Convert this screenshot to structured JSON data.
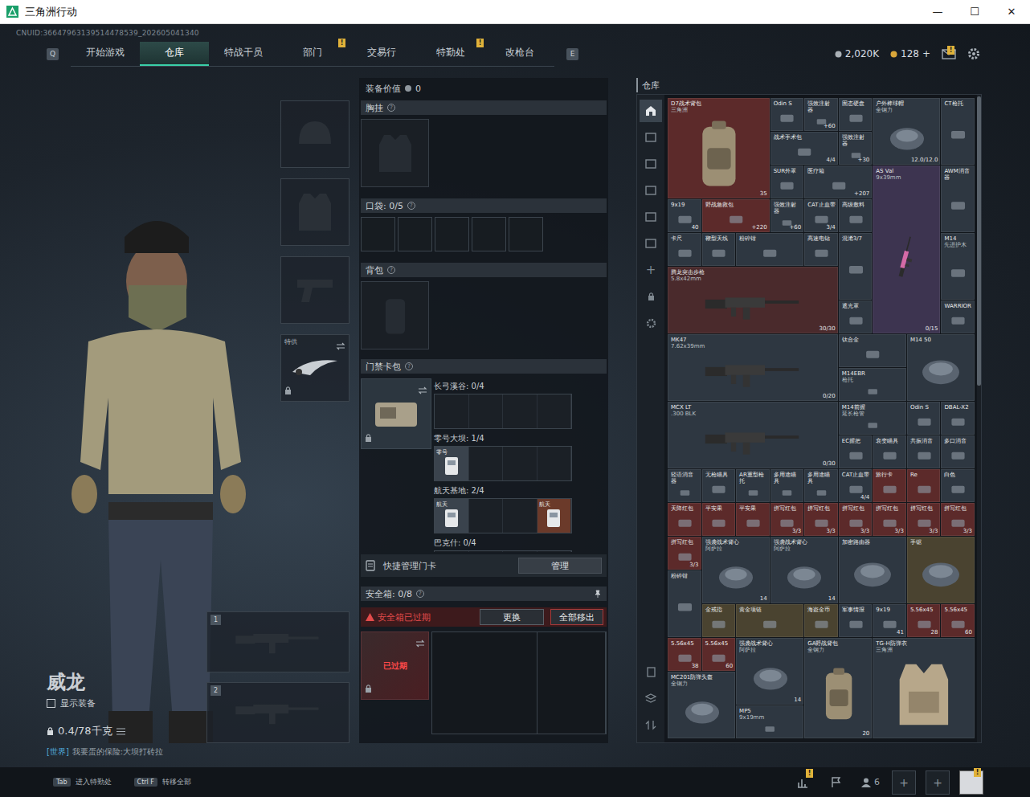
{
  "window": {
    "title": "三角洲行动",
    "controls": [
      "—",
      "☐",
      "✕"
    ]
  },
  "uid": "CNUID:36647963139514478539_202605041340",
  "nav": {
    "prev_key": "Q",
    "next_key": "E",
    "tabs": [
      {
        "label": "开始游戏",
        "selected": false,
        "badge": ""
      },
      {
        "label": "仓库",
        "selected": true,
        "badge": ""
      },
      {
        "label": "特战干员",
        "selected": false,
        "badge": ""
      },
      {
        "label": "部门",
        "selected": false,
        "badge": "!"
      },
      {
        "label": "交易行",
        "selected": false,
        "badge": ""
      },
      {
        "label": "特勤处",
        "selected": false,
        "badge": "!"
      },
      {
        "label": "改枪台",
        "selected": false,
        "badge": ""
      }
    ]
  },
  "currency": {
    "coins": "2,020K",
    "tickets": "128",
    "add": "+",
    "mail_badge": "!"
  },
  "character": {
    "name": "威龙",
    "show_gear": {
      "label": "显示装备",
      "checked": false
    },
    "weight": "0.4/78千克",
    "chat": {
      "channel": "[世界]",
      "text": "我要蛋的保险:大坝打砖拉"
    }
  },
  "gear_slots": {
    "melee": {
      "label": "特供",
      "locked": true
    },
    "weapons": [
      "1",
      "2"
    ]
  },
  "help_mark": "?",
  "loadout": {
    "value_label": "装备价值",
    "value": "0",
    "chest": "胸挂",
    "pockets": {
      "label": "口袋: 0/5",
      "slots": [
        {
          "filled": false
        },
        {
          "filled": false
        },
        {
          "filled": false
        },
        {
          "filled": false
        },
        {
          "filled": false
        }
      ]
    },
    "backpack": "背包",
    "keycards": {
      "label": "门禁卡包",
      "locked": true,
      "maps": [
        {
          "name": "长弓溪谷: 0/4",
          "slots": [
            {
              "filled": false,
              "label": "",
              "color": "#1b2026"
            },
            {
              "filled": false,
              "label": "",
              "color": "#1b2026"
            },
            {
              "filled": false,
              "label": "",
              "color": "#1b2026"
            },
            {
              "filled": false,
              "label": "",
              "color": "#1b2026"
            }
          ]
        },
        {
          "name": "零号大坝: 1/4",
          "slots": [
            {
              "filled": true,
              "label": "零号",
              "color": "#3a434d"
            },
            {
              "filled": false,
              "label": "",
              "color": "#1b2026"
            },
            {
              "filled": false,
              "label": "",
              "color": "#1b2026"
            },
            {
              "filled": false,
              "label": "",
              "color": "#1b2026"
            }
          ]
        },
        {
          "name": "航天基地: 2/4",
          "slots": [
            {
              "filled": true,
              "label": "航天",
              "color": "#3a434d"
            },
            {
              "filled": false,
              "label": "",
              "color": "#1b2026"
            },
            {
              "filled": false,
              "label": "",
              "color": "#1b2026"
            },
            {
              "filled": true,
              "label": "航天",
              "color": "#6b3a2a"
            }
          ]
        },
        {
          "name": "巴克什: 0/4",
          "slots": [
            {
              "filled": false,
              "label": "",
              "color": "#1b2026"
            },
            {
              "filled": false,
              "label": "",
              "color": "#1b2026"
            },
            {
              "filled": false,
              "label": "",
              "color": "#1b2026"
            },
            {
              "filled": false,
              "label": "",
              "color": "#1b2026"
            }
          ]
        }
      ]
    },
    "quick_label": "快捷管理门卡",
    "manage": "管理",
    "safe": {
      "label": "安全箱: 0/8",
      "warning": "安全箱已过期",
      "replace": "更换",
      "remove_all": "全部移出",
      "stamp": "已过期",
      "expired": true
    }
  },
  "storage": {
    "title": "仓库",
    "add": "+",
    "tabs": [
      {
        "selected": true
      },
      {
        "selected": false
      },
      {
        "selected": false
      },
      {
        "selected": false
      },
      {
        "selected": false
      },
      {
        "selected": false
      }
    ],
    "items": [
      {
        "kind": "bag",
        "name": "D7战术背包",
        "sub": "三角洲",
        "count": "35",
        "color": "#5c2a2a"
      },
      {
        "kind": "s",
        "name": "Odin S",
        "sub": "",
        "count": "",
        "color": "#2e3741"
      },
      {
        "kind": "s",
        "name": "强效注射器",
        "sub": "",
        "count": "+60",
        "color": "#2e3741"
      },
      {
        "kind": "s",
        "name": "固态硬盘",
        "sub": "",
        "count": "",
        "color": "#2e3741"
      },
      {
        "kind": "sq2",
        "name": "户外棒球帽",
        "sub": "全钢力",
        "count": "12.0/12.0",
        "color": "#2e3741"
      },
      {
        "kind": "t2",
        "name": "CT枪托",
        "sub": "",
        "count": "",
        "color": "#2e3741"
      },
      {
        "kind": "w2",
        "name": "战术手术包",
        "sub": "",
        "count": "4/4",
        "color": "#2e3741"
      },
      {
        "kind": "s",
        "name": "强效注射器",
        "sub": "",
        "count": "+30",
        "color": "#2e3741"
      },
      {
        "kind": "s",
        "name": "SUR外罩",
        "sub": "",
        "count": "",
        "color": "#2e3741"
      },
      {
        "kind": "w2",
        "name": "医疗箱",
        "sub": "",
        "count": "+207",
        "color": "#2e3741"
      },
      {
        "kind": "tall",
        "name": "AS Val",
        "sub": "9x39mm",
        "count": "0/15",
        "color": "#3d3450"
      },
      {
        "kind": "t2",
        "name": "AWM消音器",
        "sub": "",
        "count": "",
        "color": "#2e3741"
      },
      {
        "kind": "s",
        "name": "9x19",
        "sub": "",
        "count": "40",
        "color": "#2e3741"
      },
      {
        "kind": "w2",
        "name": "野战急救包",
        "sub": "",
        "count": "+220",
        "color": "#5c2a2a"
      },
      {
        "kind": "s",
        "name": "强效注射器",
        "sub": "",
        "count": "+60",
        "color": "#2e3741"
      },
      {
        "kind": "s",
        "name": "CAT止血带",
        "sub": "",
        "count": "3/4",
        "color": "#2e3741"
      },
      {
        "kind": "s",
        "name": "高级敷料",
        "sub": "",
        "count": "",
        "color": "#2e3741"
      },
      {
        "kind": "s",
        "name": "卡尺",
        "sub": "",
        "count": "",
        "color": "#2e3741"
      },
      {
        "kind": "s",
        "name": "鞭型天线",
        "sub": "",
        "count": "",
        "color": "#2e3741"
      },
      {
        "kind": "w2",
        "name": "粉碎钳",
        "sub": "",
        "count": "",
        "color": "#2e3741"
      },
      {
        "kind": "s",
        "name": "高速电钻",
        "sub": "",
        "count": "",
        "color": "#2e3741"
      },
      {
        "kind": "t2",
        "name": "混淆3/7",
        "sub": "",
        "count": "",
        "color": "#2e3741"
      },
      {
        "kind": "t2",
        "name": "M14",
        "sub": "先进护木",
        "count": "",
        "color": "#2e3741"
      },
      {
        "kind": "gun",
        "name": "腾龙突击步枪",
        "sub": "5.8x42mm",
        "count": "30/30",
        "color": "#4a2a2c"
      },
      {
        "kind": "s",
        "name": "遮光罩",
        "sub": "",
        "count": "",
        "color": "#2e3741"
      },
      {
        "kind": "s",
        "name": "WARRIOR",
        "sub": "",
        "count": "",
        "color": "#2e3741"
      },
      {
        "kind": "gun",
        "name": "MK47",
        "sub": "7.62x39mm",
        "count": "0/20",
        "color": "#2e3741"
      },
      {
        "kind": "w2",
        "name": "钛合金",
        "sub": "",
        "count": "",
        "color": "#2e3741"
      },
      {
        "kind": "sq2",
        "name": "M14 50",
        "sub": "",
        "count": "",
        "color": "#2e3741"
      },
      {
        "kind": "w2",
        "name": "M14EBR",
        "sub": "枪托",
        "count": "",
        "color": "#2e3741"
      },
      {
        "kind": "gun",
        "name": "MCX LT",
        "sub": ".300 BLK",
        "count": "0/30",
        "color": "#2e3741"
      },
      {
        "kind": "w2",
        "name": "M14前握",
        "sub": "延长枪管",
        "count": "",
        "color": "#2e3741"
      },
      {
        "kind": "s",
        "name": "Odin S",
        "sub": "",
        "count": "",
        "color": "#2e3741"
      },
      {
        "kind": "s",
        "name": "DBAL-X2",
        "sub": "",
        "count": "",
        "color": "#2e3741"
      },
      {
        "kind": "s",
        "name": "EC握把",
        "sub": "",
        "count": "",
        "color": "#2e3741"
      },
      {
        "kind": "s",
        "name": "衰变瞄具",
        "sub": "",
        "count": "",
        "color": "#2e3741"
      },
      {
        "kind": "s",
        "name": "共振消音",
        "sub": "",
        "count": "",
        "color": "#2e3741"
      },
      {
        "kind": "s",
        "name": "多口消音",
        "sub": "",
        "count": "",
        "color": "#2e3741"
      },
      {
        "kind": "s",
        "name": "轻语消音器",
        "sub": "",
        "count": "",
        "color": "#2e3741"
      },
      {
        "kind": "s",
        "name": "无枪瞄具",
        "sub": "",
        "count": "",
        "color": "#2e3741"
      },
      {
        "kind": "s",
        "name": "AR重型枪托",
        "sub": "",
        "count": "",
        "color": "#2e3741"
      },
      {
        "kind": "s",
        "name": "多用途瞄具",
        "sub": "",
        "count": "",
        "color": "#2e3741"
      },
      {
        "kind": "s",
        "name": "多用途瞄具",
        "sub": "",
        "count": "",
        "color": "#2e3741"
      },
      {
        "kind": "s",
        "name": "CAT止血带",
        "sub": "",
        "count": "4/4",
        "color": "#2e3741"
      },
      {
        "kind": "s",
        "name": "旅行卡",
        "sub": "",
        "count": "",
        "color": "#5c2a2a"
      },
      {
        "kind": "s",
        "name": "Re",
        "sub": "",
        "count": "",
        "color": "#5c2a2a"
      },
      {
        "kind": "s",
        "name": "白色",
        "sub": "",
        "count": "",
        "color": "#2e3741"
      },
      {
        "kind": "s",
        "name": "天降红包",
        "sub": "",
        "count": "",
        "color": "#5c2a2a"
      },
      {
        "kind": "s",
        "name": "平安果",
        "sub": "",
        "count": "",
        "color": "#5c2a2a"
      },
      {
        "kind": "s",
        "name": "平安果",
        "sub": "",
        "count": "",
        "color": "#5c2a2a"
      },
      {
        "kind": "s",
        "name": "拼写红包",
        "sub": "",
        "count": "3/3",
        "color": "#5c2a2a"
      },
      {
        "kind": "s",
        "name": "拼写红包",
        "sub": "",
        "count": "3/3",
        "color": "#5c2a2a"
      },
      {
        "kind": "s",
        "name": "拼写红包",
        "sub": "",
        "count": "3/3",
        "color": "#5c2a2a"
      },
      {
        "kind": "s",
        "name": "拼写红包",
        "sub": "",
        "count": "3/3",
        "color": "#5c2a2a"
      },
      {
        "kind": "s",
        "name": "拼写红包",
        "sub": "",
        "count": "3/3",
        "color": "#5c2a2a"
      },
      {
        "kind": "s",
        "name": "拼写红包",
        "sub": "",
        "count": "3/3",
        "color": "#5c2a2a"
      },
      {
        "kind": "s",
        "name": "拼写红包",
        "sub": "",
        "count": "3/3",
        "color": "#5c2a2a"
      },
      {
        "kind": "sq2",
        "name": "强袭战术背心",
        "sub": "阿萨拉",
        "count": "14",
        "color": "#2e3741"
      },
      {
        "kind": "sq2",
        "name": "强袭战术背心",
        "sub": "阿萨拉",
        "count": "14",
        "color": "#2e3741"
      },
      {
        "kind": "sq2",
        "name": "加密路由器",
        "sub": "",
        "count": "",
        "color": "#2e3741"
      },
      {
        "kind": "sq2",
        "name": "手锯",
        "sub": "",
        "count": "",
        "color": "#4a4330"
      },
      {
        "kind": "t2",
        "name": "粉碎钳",
        "sub": "",
        "count": "",
        "color": "#2e3741"
      },
      {
        "kind": "s",
        "name": "金戒指",
        "sub": "",
        "count": "",
        "color": "#4a4330"
      },
      {
        "kind": "w2",
        "name": "黄金项链",
        "sub": "",
        "count": "",
        "color": "#4a4330"
      },
      {
        "kind": "s",
        "name": "海盗金币",
        "sub": "",
        "count": "",
        "color": "#4a4330"
      },
      {
        "kind": "s",
        "name": "军事情报",
        "sub": "",
        "count": "",
        "color": "#2e3741"
      },
      {
        "kind": "s",
        "name": "9x19",
        "sub": "",
        "count": "41",
        "color": "#2e3741"
      },
      {
        "kind": "s",
        "name": "5.56x45",
        "sub": "",
        "count": "28",
        "color": "#5c2a2a"
      },
      {
        "kind": "s",
        "name": "5.56x45",
        "sub": "",
        "count": "60",
        "color": "#5c2a2a"
      },
      {
        "kind": "s",
        "name": "5.56x45",
        "sub": "",
        "count": "38",
        "color": "#5c2a2a"
      },
      {
        "kind": "s",
        "name": "5.56x45",
        "sub": "",
        "count": "60",
        "color": "#5c2a2a"
      },
      {
        "kind": "sq2",
        "name": "强袭战术背心",
        "sub": "阿萨拉",
        "count": "14",
        "color": "#2e3741"
      },
      {
        "kind": "pack",
        "name": "GA野战背包",
        "sub": "全钢力",
        "count": "20",
        "color": "#2e3741"
      },
      {
        "kind": "vest",
        "name": "TG-H防弹衣",
        "sub": "三角洲",
        "count": "",
        "color": "#2e3741"
      },
      {
        "kind": "sq2",
        "name": "MC201防弹头盔",
        "sub": "全钢力",
        "count": "",
        "color": "#2e3741"
      },
      {
        "kind": "w2",
        "name": "MP5",
        "sub": "9x19mm",
        "count": "",
        "color": "#2e3741"
      }
    ]
  },
  "bottom": {
    "hotkeys": [
      {
        "key": "Tab",
        "label": "进入特勤处"
      },
      {
        "key": "Ctrl F",
        "label": "转移全部"
      }
    ],
    "stats_badge": "!",
    "friends": "6",
    "add": "+",
    "avatar_badge": "!"
  }
}
